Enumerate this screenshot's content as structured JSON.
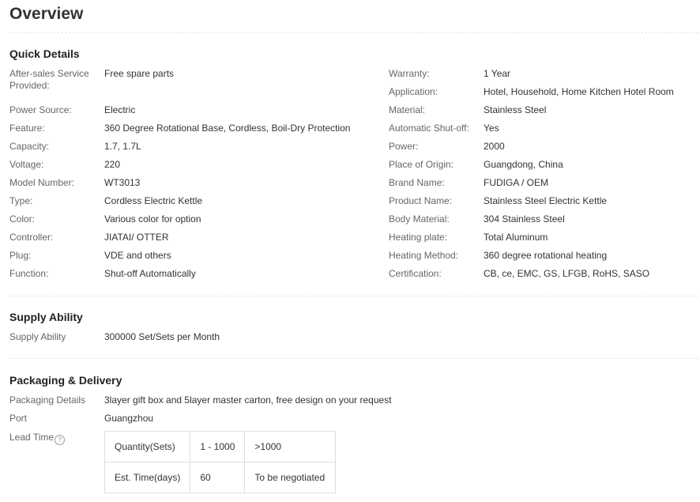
{
  "page_title": "Overview",
  "quick_details": {
    "title": "Quick Details",
    "left": [
      {
        "label": "After-sales Service Provided:",
        "value": "Free spare parts"
      },
      {
        "label": "Power Source:",
        "value": "Electric"
      },
      {
        "label": "Feature:",
        "value": "360 Degree Rotational Base, Cordless, Boil-Dry Protection"
      },
      {
        "label": "Capacity:",
        "value": "1.7, 1.7L"
      },
      {
        "label": "Voltage:",
        "value": "220"
      },
      {
        "label": "Model Number:",
        "value": "WT3013"
      },
      {
        "label": "Type:",
        "value": "Cordless Electric Kettle"
      },
      {
        "label": "Color:",
        "value": "Various color for option"
      },
      {
        "label": "Controller:",
        "value": "JIATAI/ OTTER"
      },
      {
        "label": "Plug:",
        "value": "VDE and others"
      },
      {
        "label": "Function:",
        "value": "Shut-off Automatically"
      }
    ],
    "right": [
      {
        "label": "Warranty:",
        "value": "1 Year"
      },
      {
        "label": "Application:",
        "value": "Hotel, Household, Home Kitchen Hotel Room"
      },
      {
        "label": "Material:",
        "value": "Stainless Steel"
      },
      {
        "label": "Automatic Shut-off:",
        "value": "Yes"
      },
      {
        "label": "Power:",
        "value": "2000"
      },
      {
        "label": "Place of Origin:",
        "value": "Guangdong, China"
      },
      {
        "label": "Brand Name:",
        "value": "FUDIGA / OEM"
      },
      {
        "label": "Product Name:",
        "value": "Stainless Steel Electric Kettle"
      },
      {
        "label": "Body Material:",
        "value": "304 Stainless Steel"
      },
      {
        "label": "Heating plate:",
        "value": "Total Aluminum"
      },
      {
        "label": "Heating Method:",
        "value": "360 degree rotational heating"
      },
      {
        "label": "Certification:",
        "value": "CB, ce, EMC, GS, LFGB, RoHS, SASO"
      }
    ]
  },
  "supply_ability": {
    "title": "Supply Ability",
    "label": "Supply Ability",
    "value": "300000 Set/Sets per Month"
  },
  "packaging": {
    "title": "Packaging & Delivery",
    "details_label": "Packaging Details",
    "details_value": "3layer gift box and 5layer master carton, free design on your request",
    "port_label": "Port",
    "port_value": "Guangzhou",
    "lead_time_label": "Lead Time",
    "help_icon": "question-circle-icon",
    "help_glyph": "?",
    "lead_table": {
      "row1": [
        "Quantity(Sets)",
        "1 - 1000",
        ">1000"
      ],
      "row2": [
        "Est. Time(days)",
        "60",
        "To be negotiated"
      ]
    }
  }
}
